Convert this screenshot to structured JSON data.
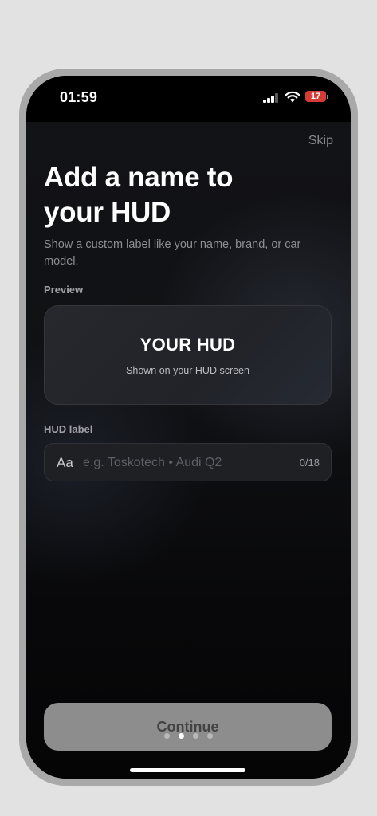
{
  "status_bar": {
    "time": "01:59",
    "battery_level": "17",
    "icons": [
      "cellular-signal-icon",
      "wifi-icon",
      "battery-icon"
    ],
    "battery_color": "#d53c35"
  },
  "header": {
    "skip_label": "Skip"
  },
  "main": {
    "title": "Add a name to your HUD",
    "subtitle": "Show a custom label like your name, brand, or car model."
  },
  "preview": {
    "section_label": "Preview",
    "card_title": "YOUR HUD",
    "card_subtitle": "Shown on your HUD screen"
  },
  "hud_label": {
    "section_label": "HUD label",
    "prefix_icon_text": "Aa",
    "value": "",
    "placeholder": "e.g. Toskotech • Audi Q2",
    "counter": "0/18"
  },
  "footer": {
    "continue_label": "Continue",
    "page_indicator": {
      "total": 4,
      "current": 2
    }
  }
}
